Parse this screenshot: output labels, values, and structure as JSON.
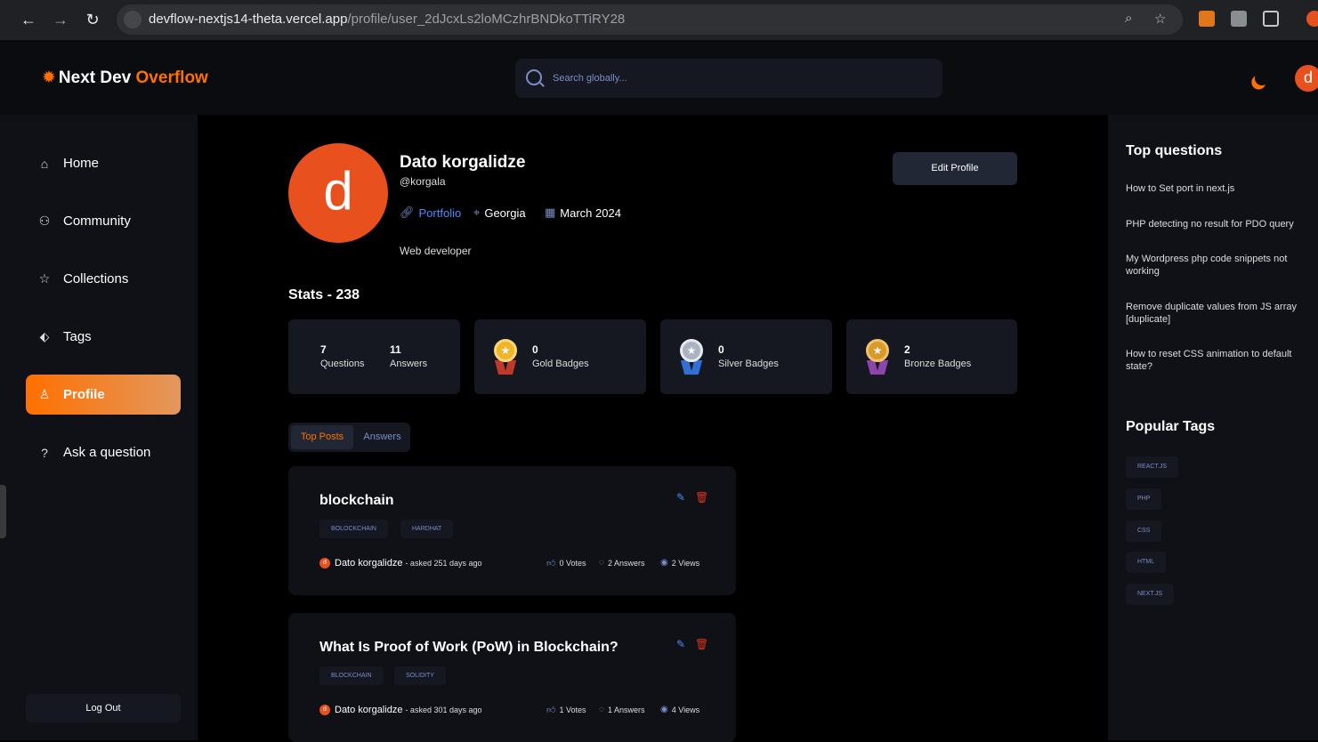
{
  "browser": {
    "url_host": "devflow-nextjs14-theta.vercel.app",
    "url_path": "/profile/user_2dJcxLs2loMCzhrBNDkoTTiRY28"
  },
  "header": {
    "logo_prefix": "Next Dev",
    "logo_accent": "Overflow",
    "search_placeholder": "Search globally...",
    "avatar_letter": "d"
  },
  "sidebar": {
    "items": [
      {
        "label": "Home",
        "icon": "home-icon"
      },
      {
        "label": "Community",
        "icon": "users-icon"
      },
      {
        "label": "Collections",
        "icon": "star-icon"
      },
      {
        "label": "Tags",
        "icon": "tag-icon"
      },
      {
        "label": "Profile",
        "icon": "user-icon",
        "active": true
      },
      {
        "label": "Ask a question",
        "icon": "question-icon"
      }
    ],
    "logout_label": "Log Out"
  },
  "profile": {
    "avatar_letter": "d",
    "name": "Dato korgalidze",
    "username": "@korgala",
    "portfolio_label": "Portfolio",
    "location": "Georgia",
    "joined": "March 2024",
    "bio": "Web developer",
    "edit_label": "Edit Profile"
  },
  "stats": {
    "title": "Stats - 238",
    "questions": {
      "value": "7",
      "label": "Questions"
    },
    "answers": {
      "value": "11",
      "label": "Answers"
    },
    "gold": {
      "value": "0",
      "label": "Gold Badges",
      "color": "#f0b429"
    },
    "silver": {
      "value": "0",
      "label": "Silver Badges",
      "color": "#c0c8d2"
    },
    "bronze": {
      "value": "2",
      "label": "Bronze Badges",
      "color": "#e0a030"
    }
  },
  "tabs": {
    "top_posts": "Top Posts",
    "answers": "Answers"
  },
  "posts": [
    {
      "title": "blockchain",
      "tags": [
        "BOLOCKCHAIN",
        "HARDHAT"
      ],
      "author": "Dato korgalidze",
      "author_initial": "d",
      "asked": "- asked 251 days ago",
      "votes": "0 Votes",
      "answers": "2 Answers",
      "views": "2 Views"
    },
    {
      "title": "What Is Proof of Work (PoW) in Blockchain?",
      "tags": [
        "BLOCKCHAIN",
        "SOLIDITY"
      ],
      "author": "Dato korgalidze",
      "author_initial": "d",
      "asked": "- asked 301 days ago",
      "votes": "1 Votes",
      "answers": "1 Answers",
      "views": "4 Views"
    }
  ],
  "right_sidebar": {
    "top_questions_title": "Top questions",
    "top_questions": [
      "How to Set port in next.js",
      "PHP detecting no result for PDO query",
      "My Wordpress php code snippets not working",
      "Remove duplicate values from JS array [duplicate]",
      "How to reset CSS animation to default state?"
    ],
    "popular_tags_title": "Popular Tags",
    "popular_tags": [
      "REACT.JS",
      "PHP",
      "CSS",
      "HTML",
      "NEXT.JS"
    ]
  },
  "colors": {
    "accent": "#ff7000",
    "link": "#4a8cff",
    "muted": "#7b8ec8"
  }
}
